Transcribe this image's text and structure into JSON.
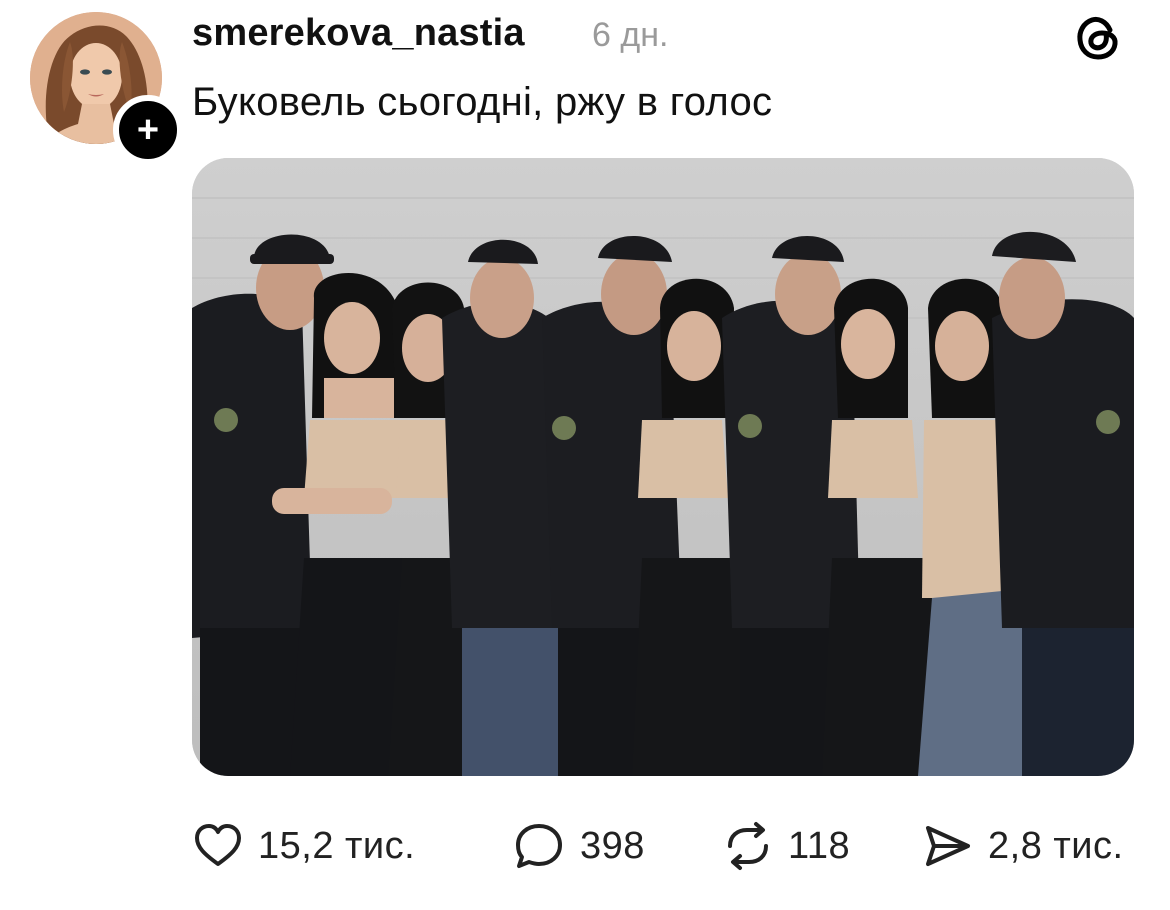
{
  "post": {
    "username": "smerekova_nastia",
    "time": "6 дн.",
    "text": "Буковель сьогодні, ржу в голос",
    "follow_symbol": "+"
  },
  "icons": {
    "avatar": "avatar",
    "follow": "plus-icon",
    "app": "threads-logo-icon",
    "like": "heart-icon",
    "reply": "comment-bubble-icon",
    "repost": "repost-arrows-icon",
    "share": "send-icon"
  },
  "actions": {
    "likes": "15,2 тис.",
    "replies": "398",
    "reposts": "118",
    "shares": "2,8 тис."
  },
  "colors": {
    "text": "#111111",
    "muted": "#9a9a9a",
    "jackets": "#1b1c20",
    "skin": "#d8b49c",
    "top": "#d9bfa5",
    "jeans_blue": "#5f6e85"
  }
}
